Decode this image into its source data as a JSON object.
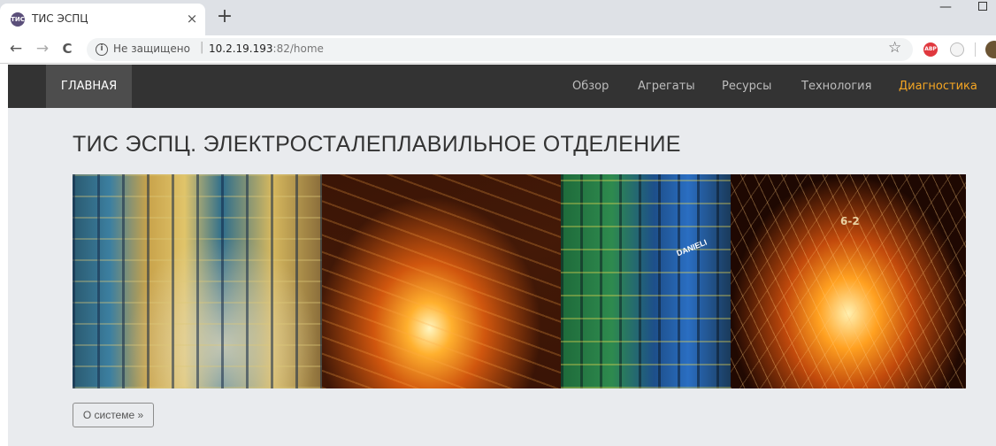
{
  "browser": {
    "tab_title": "ТИС ЭСПЦ",
    "favicon_text": "ТИС",
    "close_glyph": "×",
    "new_tab_glyph": "+",
    "back_glyph": "←",
    "forward_glyph": "→",
    "reload_glyph": "C",
    "security_label": "Не защищено",
    "url_host": "10.2.19.193",
    "url_rest": ":82/home",
    "star_glyph": "☆",
    "abp_text": "ABP",
    "info_glyph": "i",
    "separator": "|"
  },
  "navbar": {
    "brand": "ГЛАВНАЯ",
    "items": [
      {
        "label": "Обзор",
        "active": false
      },
      {
        "label": "Агрегаты",
        "active": false
      },
      {
        "label": "Ресурсы",
        "active": false
      },
      {
        "label": "Технология",
        "active": false
      },
      {
        "label": "Диагностика",
        "active": true
      }
    ],
    "active_color": "#f5a623"
  },
  "main": {
    "title": "ТИС ЭСПЦ. ЭЛЕКТРОСТАЛЕПЛАВИЛЬНОЕ ОТДЕЛЕНИЕ",
    "banner_photos": [
      "plant-structure-photo",
      "molten-steel-photo",
      "danieli-equipment-photo",
      "ladle-sparks-photo"
    ],
    "danieli_text": "DANIELI",
    "ladle_text": "6-2",
    "about_button": "О системе »"
  }
}
